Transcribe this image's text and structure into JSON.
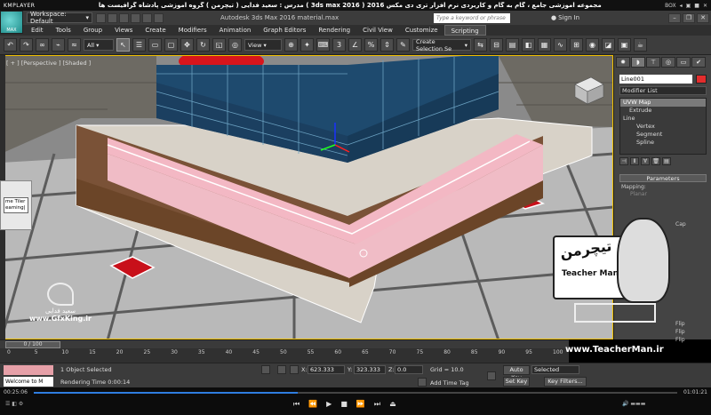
{
  "player": {
    "brand": "KMPLAYER",
    "title": "مجموعه آموزشی جامع ، گام به گام و کاربردی نرم افزار تری دی مکس 2016  ( 3ds max 2016 )  مدرس : سعید فدایی ( تیچرمن ) گروه آموزشی پادشاه گرافیست ها",
    "right_controls": [
      "BOX",
      "◂",
      "▣",
      "■",
      "✕"
    ],
    "time_elapsed": "00:25:06",
    "time_total": "01:01:21",
    "progress_fraction": 0.41
  },
  "max": {
    "logo_text": "MAX",
    "workspace": "Workspace: Default",
    "app_title": "Autodesk 3ds Max 2016      material.max",
    "search_placeholder": "Type a keyword or phrase",
    "sign_in": "Sign In",
    "window_buttons": [
      "–",
      "❐",
      "✕"
    ]
  },
  "menu": [
    "Edit",
    "Tools",
    "Group",
    "Views",
    "Create",
    "Modifiers",
    "Animation",
    "Graph Editors",
    "Rendering",
    "Civil View",
    "Customize",
    "Scripting"
  ],
  "toolbar": {
    "filter": "All",
    "ref_coord": "View",
    "selection_set": "Create Selection Se"
  },
  "viewport": {
    "label": "[ + ] [Perspective ] [Shaded ]"
  },
  "float_dialog": {
    "line1": "me Tiler",
    "line2": "eaming|"
  },
  "watermark_left": {
    "fa": "سعید فدایی",
    "url": "www.GfxKing.ir"
  },
  "command_panel": {
    "object_name": "Line001",
    "modifier_list": "Modifier List",
    "stack": [
      "UVW Map",
      "Extrude",
      "Line",
      "Vertex",
      "Segment",
      "Spline"
    ],
    "rollout": "Parameters",
    "mapping_label": "Mapping:",
    "radio_planar": "Planar",
    "cap_label": "Cap",
    "flip_labels": [
      "Flip",
      "Flip",
      "Flip"
    ]
  },
  "teacherman": {
    "fa_name": "تیچرمن",
    "en_name": "Teacher Man",
    "url": "www.TeacherMan.ir"
  },
  "time_slider": {
    "thumb": "0 / 100",
    "ticks": [
      "0",
      "5",
      "10",
      "15",
      "20",
      "25",
      "30",
      "35",
      "40",
      "45",
      "50",
      "55",
      "60",
      "65",
      "70",
      "75",
      "80",
      "85",
      "90",
      "95",
      "100"
    ]
  },
  "status": {
    "welcome": "Welcome to M",
    "selected": "1 Object Selected",
    "rendering_time": "Rendering Time  0:00:14",
    "x_label": "X:",
    "x_value": "623.333",
    "y_label": "Y:",
    "y_value": "323.333",
    "z_label": "Z:",
    "z_value": "0.0",
    "grid": "Grid = 10.0",
    "add_time_tag": "Add Time Tag",
    "auto_key": "Auto Key",
    "set_key": "Set Key",
    "selected_drop": "Selected",
    "key_filters": "Key Filters..."
  }
}
